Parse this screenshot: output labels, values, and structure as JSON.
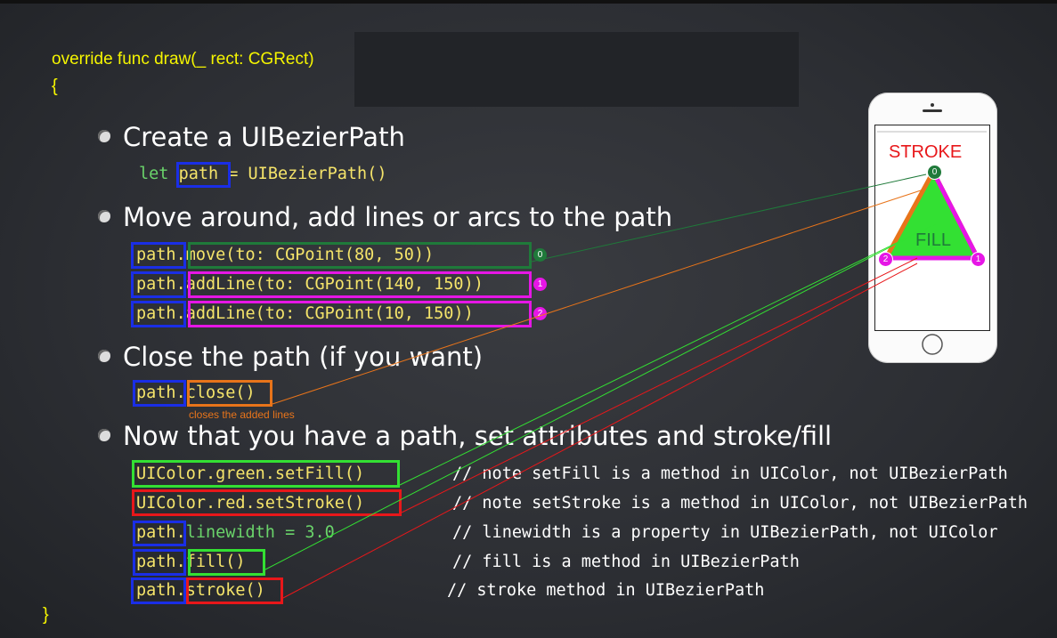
{
  "header": {
    "signature": "override func draw(_ rect: CGRect)",
    "open_brace": "{",
    "close_brace": "}"
  },
  "bullets": [
    "Create a UIBezierPath",
    "Move around, add lines or arcs to the path",
    "Close the path (if you want)",
    "Now that you have a path, set attributes and stroke/fill"
  ],
  "code": {
    "let_kw": "let",
    "path_var": "path",
    "eq_ctor": " = UIBezierPath()",
    "path": "path",
    "dot": ".",
    "move": "move(to: CGPoint(80, 50))",
    "add1": "addLine(to: CGPoint(140, 150))",
    "add2": "addLine(to: CGPoint(10, 150))",
    "close": "close()",
    "close_note": "closes the added lines",
    "set_fill": "UIColor.green.setFill()",
    "set_stroke": "UIColor.red.setStroke()",
    "linewidth": "linewidth = 3.0",
    "fill": "fill()",
    "stroke": "stroke()"
  },
  "comments": [
    "// note setFill is a method in UIColor, not UIBezierPath",
    "// note setStroke is a method in UIColor, not UIBezierPath",
    "// linewidth is a property in UIBezierPath, not UIColor",
    "// fill is a method in UIBezierPath",
    "// stroke method in UIBezierPath"
  ],
  "badges": [
    "0",
    "1",
    "2"
  ],
  "phone": {
    "stroke_label": "STROKE",
    "fill_label": "FILL"
  },
  "colors": {
    "code_yellow": "#f5f500",
    "box_blue": "#1a2ee6",
    "box_darkgreen": "#1f7a3a",
    "box_magenta": "#e616e6",
    "box_orange": "#e8741a",
    "box_green": "#33e033",
    "box_red": "#e8171a"
  }
}
